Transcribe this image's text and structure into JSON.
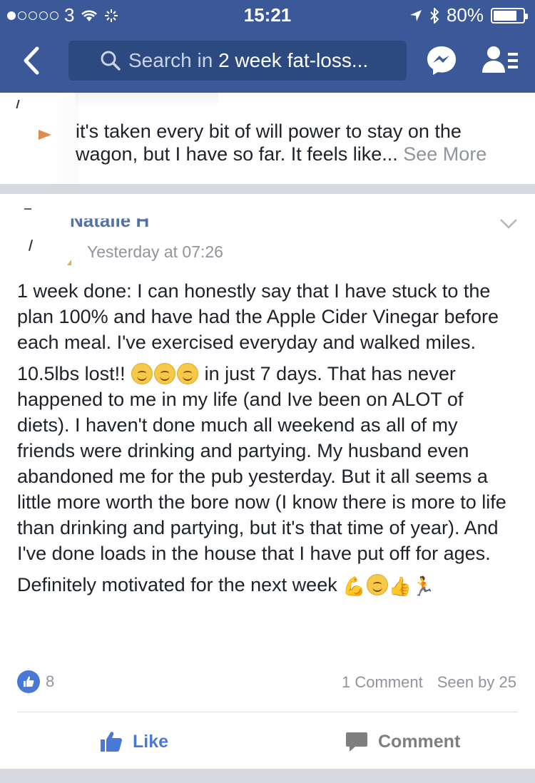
{
  "status_bar": {
    "carrier": "3",
    "time": "15:21",
    "battery": "80%",
    "battery_level": 0.8
  },
  "nav": {
    "search_prefix": "Search in",
    "search_group": "2 week fat-loss..."
  },
  "previous_post": {
    "text": "it's taken every bit of will power to stay on the wagon, but I have so far. It feels like...",
    "see_more": "See More"
  },
  "post": {
    "author": "Natalie H",
    "timestamp": "Yesterday at 07:26",
    "paragraph_1": "1 week done: I can honestly say that I have stuck to the plan 100% and have had the Apple Cider Vinegar before each meal. I've exercised everyday and walked miles.",
    "paragraph_2_start": "10.5lbs lost!!",
    "paragraph_2_rest": "in just 7 days. That has never happened to me in my life (and Ive been on ALOT of diets). I haven't done much all weekend as all of my friends were drinking and partying. My husband even abandoned me for the pub yesterday. But it all seems a little more worth the bore now (I know there is more to life than drinking and partying, but it's that time of year). And I've done loads in the house that I have put off for ages.",
    "paragraph_3": "Definitely motivated for the next week",
    "emoji_icons": [
      "smile-emoji",
      "smile-emoji",
      "smile-emoji",
      "flexed-biceps-emoji",
      "smile-emoji",
      "thumbs-up-emoji",
      "runner-emoji"
    ],
    "like_count": "8",
    "comments": "1 Comment",
    "seen_by": "Seen by 25"
  },
  "actions": {
    "like": "Like",
    "comment": "Comment"
  },
  "colors": {
    "brand": "#3b5998",
    "link": "#4a78d6",
    "muted": "#90949c"
  }
}
